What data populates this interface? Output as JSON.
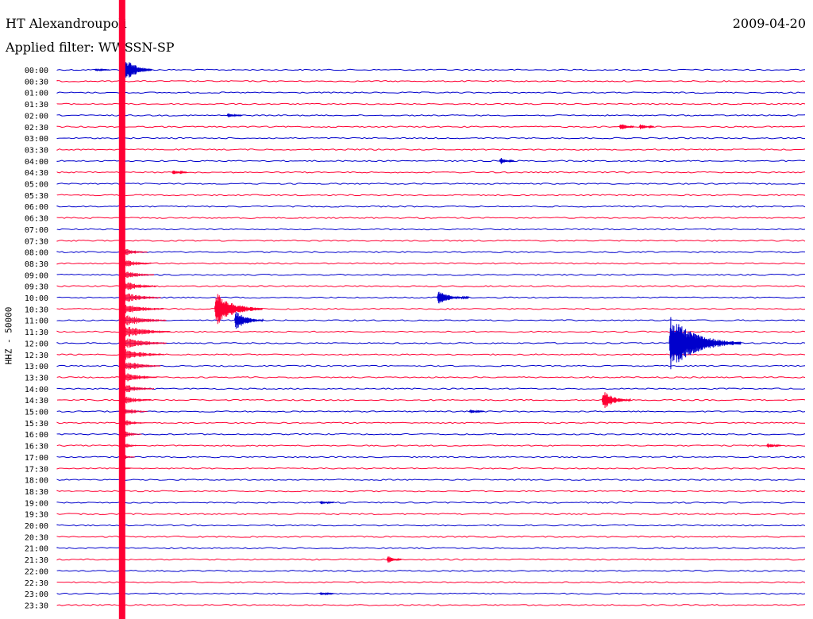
{
  "header": {
    "station": "HT Alexandroupoli",
    "filter": "Applied filter: WWSSN-SP",
    "date": "2009-04-20"
  },
  "chart_data": {
    "type": "line",
    "title": "HT Alexandroupoli",
    "ylabel": "HHZ - 50000",
    "row_labels": [
      "00:00",
      "00:30",
      "01:00",
      "01:30",
      "02:00",
      "02:30",
      "03:00",
      "03:30",
      "04:00",
      "04:30",
      "05:00",
      "05:30",
      "06:00",
      "06:30",
      "07:00",
      "07:30",
      "08:00",
      "08:30",
      "09:00",
      "09:30",
      "10:00",
      "10:30",
      "11:00",
      "11:30",
      "12:00",
      "12:30",
      "13:00",
      "13:30",
      "14:00",
      "14:30",
      "15:00",
      "15:30",
      "16:00",
      "16:30",
      "17:00",
      "17:30",
      "18:00",
      "18:30",
      "19:00",
      "19:30",
      "20:00",
      "20:30",
      "21:00",
      "21:30",
      "22:00",
      "22:30",
      "23:00",
      "23:30"
    ],
    "row_colors": [
      "#0000cc",
      "#ff0033"
    ],
    "events": [
      {
        "row": "00:00",
        "minute": 1.5,
        "amplitude": 0.1
      },
      {
        "row": "00:00",
        "minute": 2.5,
        "amplitude": 25
      },
      {
        "row": "02:00",
        "minute": 6.8,
        "amplitude": 0.15
      },
      {
        "row": "02:30",
        "minute": 22.5,
        "amplitude": 0.3
      },
      {
        "row": "02:30",
        "minute": 23.3,
        "amplitude": 0.25
      },
      {
        "row": "04:00",
        "minute": 17.7,
        "amplitude": 0.25
      },
      {
        "row": "04:30",
        "minute": 4.6,
        "amplitude": 0.2
      },
      {
        "row": "10:30",
        "minute": 6.3,
        "amplitude": 1.0
      },
      {
        "row": "11:00",
        "minute": 7.1,
        "amplitude": 0.6
      },
      {
        "row": "10:00",
        "minute": 15.2,
        "amplitude": 10
      },
      {
        "row": "12:00",
        "minute": 24.5,
        "amplitude": 1.5
      },
      {
        "row": "14:30",
        "minute": 21.8,
        "amplitude": 0.6
      },
      {
        "row": "15:00",
        "minute": 16.5,
        "amplitude": 0.15
      },
      {
        "row": "16:30",
        "minute": 28.4,
        "amplitude": 0.2
      },
      {
        "row": "19:00",
        "minute": 10.5,
        "amplitude": 0.15
      },
      {
        "row": "21:30",
        "minute": 13.2,
        "amplitude": 0.3
      },
      {
        "row": "23:00",
        "minute": 10.5,
        "amplitude": 0.12
      }
    ],
    "x_range_minutes": [
      0,
      30
    ],
    "grid": false
  }
}
